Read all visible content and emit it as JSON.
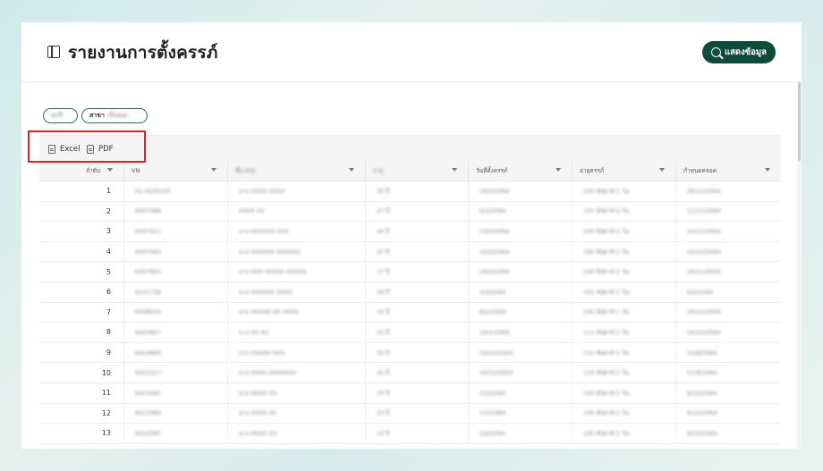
{
  "header": {
    "title": "รายงานการตั้งครรภ์",
    "show_button_label": "แสดงข้อมูล"
  },
  "filters": {
    "chip1_value": "ทุกปี",
    "chip2_label": "สาขา",
    "chip2_value": "ทั้งหมด"
  },
  "export": {
    "excel_label": "Excel",
    "pdf_label": "PDF"
  },
  "table": {
    "headers": [
      "ลำดับ",
      "VN",
      "ชื่อ-สกุล",
      "อายุ",
      "วันที่ตั้งครรภ์",
      "อายุครรภ์",
      "กำหนดคลอด"
    ],
    "rows": [
      {
        "no": "1",
        "vn": "01-0220125",
        "name": "นาง XXXX XXXX",
        "age": "35 ปี",
        "date": "10/2/2564",
        "ga": "100 สัปดาห์ 1 วัน",
        "due": "30/11/2564"
      },
      {
        "no": "2",
        "vn": "6307066",
        "name": "XXXX XX",
        "age": "27 ปี",
        "date": "6/2/2564",
        "ga": "101 สัปดาห์ 2 วัน",
        "due": "11/11/2564"
      },
      {
        "no": "3",
        "vn": "6307421",
        "name": "นาง XXXXXX XXX",
        "age": "45 ปี",
        "date": "10/2/2564",
        "ga": "100 สัปดาห์ 2 วัน",
        "due": "10/11/2564"
      },
      {
        "no": "4",
        "vn": "6307593",
        "name": "นาง XXXXXX XXXXXX",
        "age": "37 ปี",
        "date": "10/2/2564",
        "ga": "100 สัปดาห์ 2 วัน",
        "due": "10/12/2564"
      },
      {
        "no": "5",
        "vn": "6307605",
        "name": "นาง XXX XXXXX XXXXX",
        "age": "17 ปี",
        "date": "10/2/2564",
        "ga": "100 สัปดาห์ 2 วัน",
        "due": "20/11/2564"
      },
      {
        "no": "6",
        "vn": "6101736",
        "name": "นาง XXXXXX XXXX",
        "age": "18 ปี",
        "date": "2/3/2564",
        "ga": "101 สัปดาห์ 1 วัน",
        "due": "6/2/2564"
      },
      {
        "no": "7",
        "vn": "6008524",
        "name": "นาง XXXXX XX XXXX",
        "age": "32 ปี",
        "date": "8/2/2564",
        "ga": "100 สัปดาห์ 1 วัน",
        "due": "30/11/2564"
      },
      {
        "no": "8",
        "vn": "6403957",
        "name": "นาง XX XX",
        "age": "21 ปี",
        "date": "10/1/2564",
        "ga": "111 สัปดาห์ 2 วัน",
        "due": "20/10/2564"
      },
      {
        "no": "9",
        "vn": "6410966",
        "name": "นาง XXXXX XXX",
        "age": "35 ปี",
        "date": "10/12/2563",
        "ga": "115 สัปดาห์ 1 วัน",
        "due": "21/9/2564"
      },
      {
        "no": "10",
        "vn": "6412327",
        "name": "นาง XXXX XXXXXXX",
        "age": "41 ปี",
        "date": "10/12/2563",
        "ga": "115 สัปดาห์ 2 วัน",
        "due": "21/9/2564"
      },
      {
        "no": "11",
        "vn": "6413385",
        "name": "นาง XXXX XX",
        "age": "23 ปี",
        "date": "1/2/2564",
        "ga": "100 สัปดาห์ 2 วัน",
        "due": "6/12/2564"
      },
      {
        "no": "12",
        "vn": "6413385",
        "name": "นาง XXXX XX",
        "age": "23 ปี",
        "date": "1/2/2564",
        "ga": "100 สัปดาห์ 2 วัน",
        "due": "6/12/2564"
      },
      {
        "no": "13",
        "vn": "6413385",
        "name": "นาง XXXX XX",
        "age": "23 ปี",
        "date": "1/2/2564",
        "ga": "100 สัปดาห์ 2 วัน",
        "due": "6/12/2564"
      }
    ]
  },
  "colors": {
    "primary": "#0f4a3a",
    "highlight_frame": "#e02020"
  }
}
